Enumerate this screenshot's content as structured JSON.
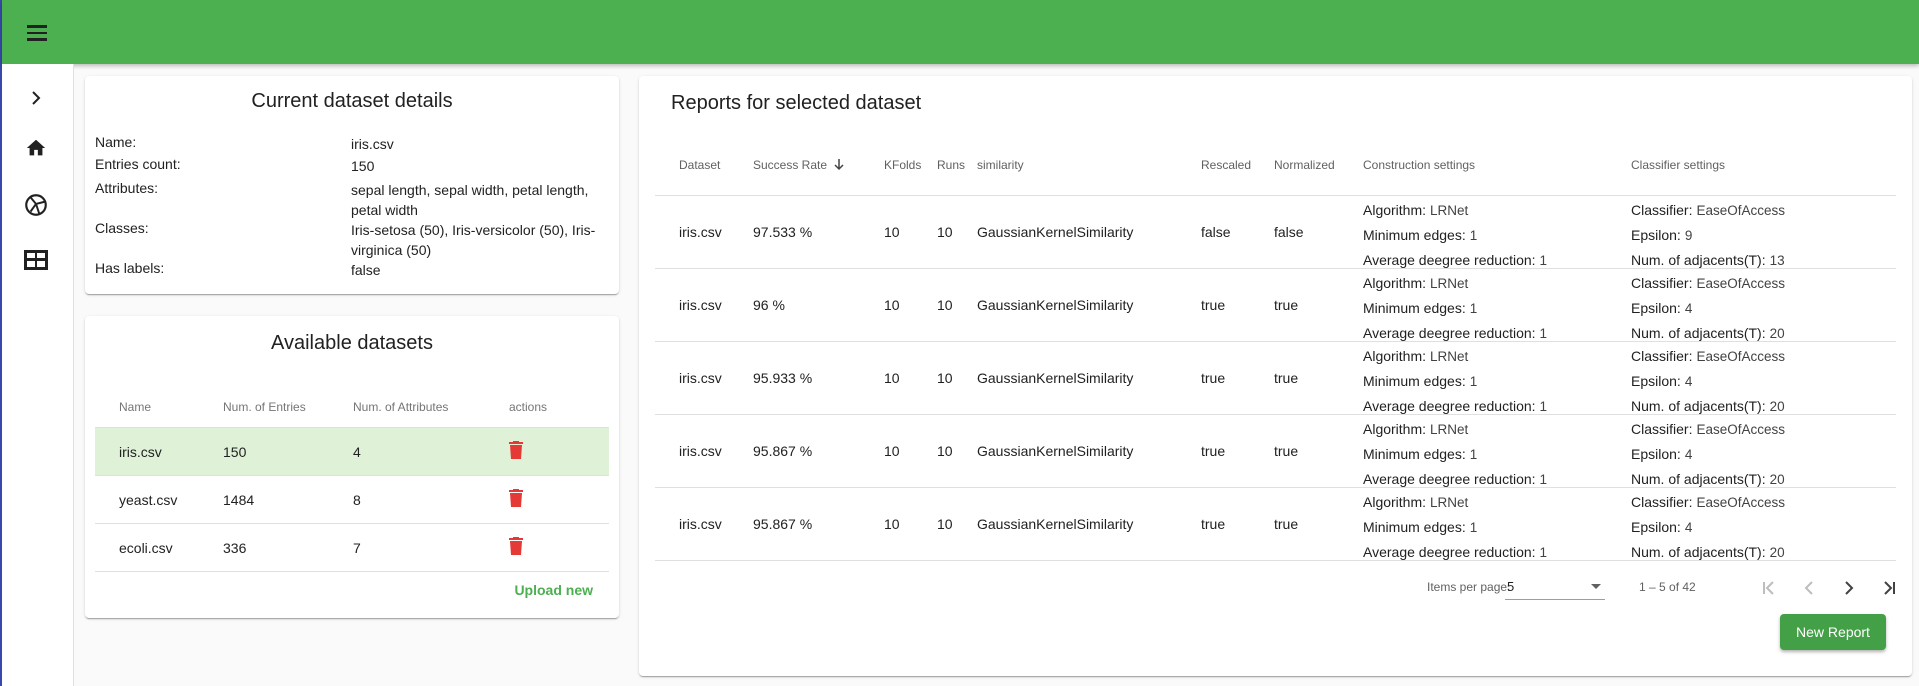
{
  "toolbar": {
    "menu_icon": "menu-icon"
  },
  "sidenav": {
    "icons": [
      "chevron-right-icon",
      "home-icon",
      "globe-icon",
      "table-icon"
    ]
  },
  "details": {
    "title": "Current dataset details",
    "rows": [
      {
        "label": "Name:",
        "value": "iris.csv"
      },
      {
        "label": "Entries count:",
        "value": "150"
      },
      {
        "label": "Attributes:",
        "value": "sepal length, sepal width, petal length, petal width"
      },
      {
        "label": "Classes:",
        "value": "Iris-setosa (50), Iris-versicolor (50), Iris-virginica (50)"
      },
      {
        "label": "Has labels:",
        "value": "false"
      }
    ]
  },
  "available": {
    "title": "Available datasets",
    "headers": [
      "Name",
      "Num. of Entries",
      "Num. of Attributes",
      "actions"
    ],
    "rows": [
      {
        "name": "iris.csv",
        "entries": "150",
        "attributes": "4"
      },
      {
        "name": "yeast.csv",
        "entries": "1484",
        "attributes": "8"
      },
      {
        "name": "ecoli.csv",
        "entries": "336",
        "attributes": "7"
      }
    ],
    "upload_label": "Upload new",
    "colors": {
      "selected_row": "#dff2d8",
      "delete_icon": "#e53935",
      "accent": "#4caf50"
    }
  },
  "reports": {
    "title": "Reports for selected dataset",
    "headers": [
      "Dataset",
      "Success Rate",
      "KFolds",
      "Runs",
      "similarity",
      "Rescaled",
      "Normalized",
      "Construction settings",
      "Classifier settings"
    ],
    "construction_labels": [
      "Algorithm:",
      "Minimum edges:",
      "Average deegree reduction:"
    ],
    "classifier_labels": [
      "Classifier:",
      "Epsilon:",
      "Num. of adjacents(T):"
    ],
    "rows": [
      {
        "dataset": "iris.csv",
        "rate": "97.533 %",
        "kfolds": "10",
        "runs": "10",
        "similarity": "GaussianKernelSimilarity",
        "rescaled": "false",
        "normalized": "false",
        "algorithm": "LRNet",
        "min_edges": "1",
        "avg_red": "1",
        "classifier": "EaseOfAccess",
        "epsilon": "9",
        "adjacents": "13"
      },
      {
        "dataset": "iris.csv",
        "rate": "96 %",
        "kfolds": "10",
        "runs": "10",
        "similarity": "GaussianKernelSimilarity",
        "rescaled": "true",
        "normalized": "true",
        "algorithm": "LRNet",
        "min_edges": "1",
        "avg_red": "1",
        "classifier": "EaseOfAccess",
        "epsilon": "4",
        "adjacents": "20"
      },
      {
        "dataset": "iris.csv",
        "rate": "95.933 %",
        "kfolds": "10",
        "runs": "10",
        "similarity": "GaussianKernelSimilarity",
        "rescaled": "true",
        "normalized": "true",
        "algorithm": "LRNet",
        "min_edges": "1",
        "avg_red": "1",
        "classifier": "EaseOfAccess",
        "epsilon": "4",
        "adjacents": "20"
      },
      {
        "dataset": "iris.csv",
        "rate": "95.867 %",
        "kfolds": "10",
        "runs": "10",
        "similarity": "GaussianKernelSimilarity",
        "rescaled": "true",
        "normalized": "true",
        "algorithm": "LRNet",
        "min_edges": "1",
        "avg_red": "1",
        "classifier": "EaseOfAccess",
        "epsilon": "4",
        "adjacents": "20"
      },
      {
        "dataset": "iris.csv",
        "rate": "95.867 %",
        "kfolds": "10",
        "runs": "10",
        "similarity": "GaussianKernelSimilarity",
        "rescaled": "true",
        "normalized": "true",
        "algorithm": "LRNet",
        "min_edges": "1",
        "avg_red": "1",
        "classifier": "EaseOfAccess",
        "epsilon": "4",
        "adjacents": "20"
      }
    ],
    "paginator": {
      "label": "Items per page:",
      "page_size": "5",
      "range": "1 – 5 of 42"
    },
    "new_report_label": "New Report",
    "colors": {
      "toolbar": "#4caf50",
      "button": "#43a047"
    }
  }
}
